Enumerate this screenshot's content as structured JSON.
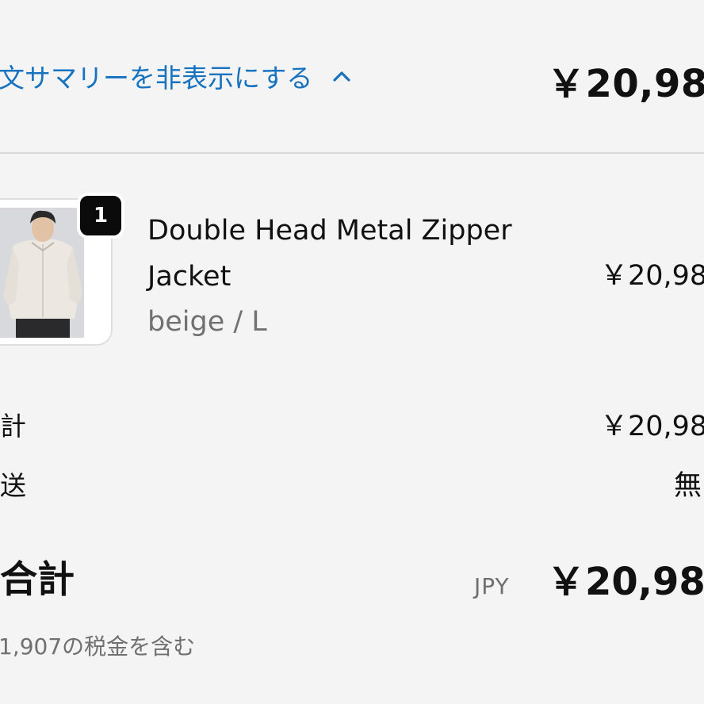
{
  "summary_toggle": {
    "label": "文サマリーを非表示にする",
    "icon": "chevron-up-icon",
    "color": "#1773c0"
  },
  "header": {
    "total": "￥20,98"
  },
  "product": {
    "quantity": "1",
    "name": "Double Head Metal Zipper Jacket",
    "variant": "beige / L",
    "price": "￥20,98"
  },
  "summary": {
    "subtotal_label": "計",
    "subtotal_value": "￥20,98",
    "shipping_label": "送",
    "shipping_value": "無",
    "total_label": "合計",
    "currency": "JPY",
    "total_value": "￥20,98",
    "tax_note": "1,907の税金を含む"
  }
}
